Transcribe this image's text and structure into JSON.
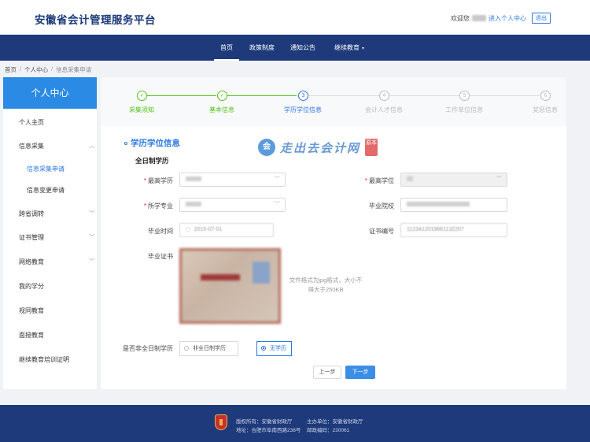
{
  "header": {
    "site_title": "安徽省会计管理服务平台",
    "welcome": "欢迎您",
    "personal_center_link": "进入个人中心",
    "logout": "退出"
  },
  "nav": {
    "items": [
      {
        "label": "首页",
        "active": true
      },
      {
        "label": "政策制度"
      },
      {
        "label": "通知公告"
      },
      {
        "label": "继续教育",
        "dropdown": true
      }
    ],
    "caret_icon": "chevron-down-icon"
  },
  "breadcrumb": [
    "首页",
    "个人中心",
    "信息采集申请"
  ],
  "breadcrumb_sep": "/",
  "sidebar": {
    "title": "个人中心",
    "items": [
      {
        "label": "个人主页"
      },
      {
        "label": "信息采集",
        "caret": "up"
      },
      {
        "label": "信息采集申请",
        "sub": true,
        "active": true
      },
      {
        "label": "信息变更申请",
        "sub": true
      },
      {
        "label": "跨省调转",
        "caret": "down"
      },
      {
        "label": "证书管理",
        "caret": "down"
      },
      {
        "label": "网络教育",
        "caret": "down"
      },
      {
        "label": "我的学分"
      },
      {
        "label": "视同教育"
      },
      {
        "label": "面授教育"
      },
      {
        "label": "继续教育培训证明"
      }
    ]
  },
  "steps": [
    {
      "label": "采集须知",
      "state": "done",
      "mark": "✓"
    },
    {
      "label": "基本信息",
      "state": "done",
      "mark": "✓"
    },
    {
      "label": "学历学位信息",
      "state": "current",
      "mark": "3"
    },
    {
      "label": "会计人才信息",
      "state": "pending",
      "mark": "4"
    },
    {
      "label": "工作单位信息",
      "state": "pending",
      "mark": "5"
    },
    {
      "label": "奖惩信息",
      "state": "pending",
      "mark": "6"
    }
  ],
  "section": {
    "title": "学历学位信息",
    "subtitle": "全日制学历"
  },
  "watermark": {
    "circle": "会",
    "text": "走出去会计网",
    "seal": "原本"
  },
  "form": {
    "highest_education_label": "最高学历",
    "highest_degree_label": "最高学位",
    "major_label": "所学专业",
    "school_label": "毕业院校",
    "grad_time_label": "毕业时间",
    "cert_no_label": "证书编号",
    "cert_label": "毕业证书",
    "grad_time_value": "2015-07-01",
    "cert_no_value": "1123412019661132207",
    "upload_hint": "文件格式为jpg格式，大小不得大于250KB"
  },
  "non_fulltime": {
    "label": "是否非全日制学历",
    "option1": "非全日制学历",
    "option2": "无学历"
  },
  "buttons": {
    "prev": "上一步",
    "next": "下一步"
  },
  "footer": {
    "copyright": "版权所有：安徽省财政厅",
    "host": "主办单位：安徽省财政厅",
    "address": "地址：合肥市阜南西路238号",
    "postcode": "邮政编码：230061"
  },
  "colors": {
    "primary": "#2b78e4",
    "nav_bg": "#1e3a7b",
    "done_green": "#52c41a",
    "pending_gray": "#bbbbbb"
  }
}
